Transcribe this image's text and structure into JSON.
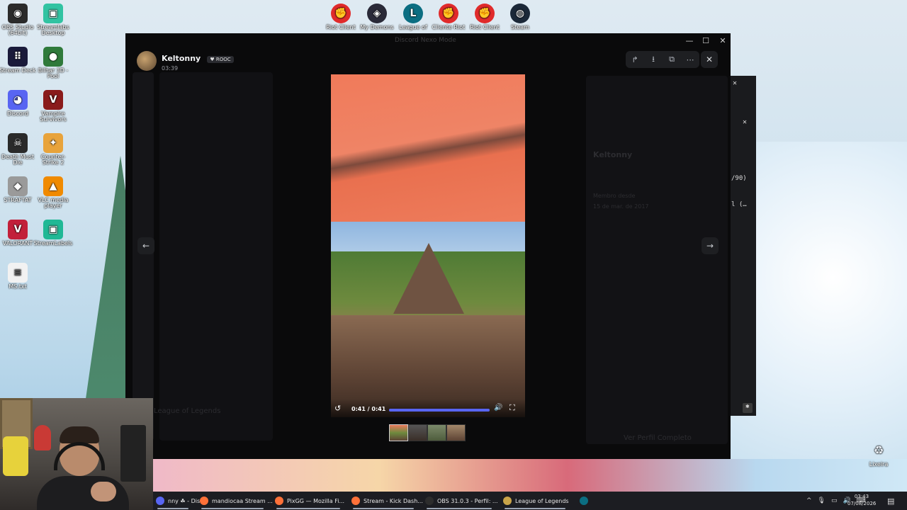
{
  "desktop": {
    "icons_left": [
      {
        "label": "OBS Studio (64bit)",
        "icon": "obs-icon",
        "color": "#2b2b2b",
        "glyph": "◉"
      },
      {
        "label": "Streamlabs Desktop",
        "icon": "streamlabs-icon",
        "color": "#31c3a2",
        "glyph": "▣"
      },
      {
        "label": "Stream Deck",
        "icon": "stream-deck-icon",
        "color": "#1a1a3a",
        "glyph": "⠿"
      },
      {
        "label": "Bilhar 3D - Pool",
        "icon": "pool-game-icon",
        "color": "#2f7a3b",
        "glyph": "●"
      },
      {
        "label": "Discord",
        "icon": "discord-icon",
        "color": "#5865f2",
        "glyph": "◕"
      },
      {
        "label": "Vampire Survivors",
        "icon": "vampire-survivors-icon",
        "color": "#8a1b1b",
        "glyph": "V"
      },
      {
        "label": "Death Must Die",
        "icon": "death-must-die-icon",
        "color": "#2a2a2a",
        "glyph": "☠"
      },
      {
        "label": "Counter-Strike 2",
        "icon": "counter-strike-icon",
        "color": "#e8a33b",
        "glyph": "✦"
      },
      {
        "label": "STRAFTAT",
        "icon": "straftat-icon",
        "color": "#9a9a9a",
        "glyph": "◆"
      },
      {
        "label": "VLC media player",
        "icon": "vlc-icon",
        "color": "#f08a00",
        "glyph": "▲"
      },
      {
        "label": "VALORANT",
        "icon": "valorant-icon",
        "color": "#c2203a",
        "glyph": "V"
      },
      {
        "label": "StreamLabels",
        "icon": "streamlabels-icon",
        "color": "#20b895",
        "glyph": "▣"
      },
      {
        "label": "MS.txt",
        "icon": "text-file-icon",
        "color": "#f2f2f2",
        "glyph": "≡"
      }
    ],
    "icons_top": [
      {
        "label": "Riot Client",
        "icon": "riot-client-icon",
        "color": "#e02b2b",
        "glyph": "✊"
      },
      {
        "label": "My Demons",
        "icon": "my-demons-icon",
        "color": "#2a2a38",
        "glyph": "◈"
      },
      {
        "label": "League of",
        "icon": "league-of-legends-icon",
        "color": "#0b6e82",
        "glyph": "L"
      },
      {
        "label": "Cliente Riot",
        "icon": "riot-client-icon",
        "color": "#e02b2b",
        "glyph": "✊"
      },
      {
        "label": "Riot Client",
        "icon": "riot-client-icon",
        "color": "#e02b2b",
        "glyph": "✊"
      },
      {
        "label": "Steam",
        "icon": "steam-icon",
        "color": "#1b2838",
        "glyph": "◍"
      }
    ],
    "recycle_bin": {
      "label": "Lixeira",
      "icon": "recycle-bin-icon"
    }
  },
  "viewer": {
    "window_title": "Discord Nexo Mode",
    "author": {
      "name": "Keltonny",
      "tag": "ROOC",
      "time": "03:39"
    },
    "toolbar": {
      "forward": "↱",
      "download": "⭳",
      "open": "⧉",
      "more": "⋯",
      "close": "✕"
    },
    "nav": {
      "prev": "←",
      "next": "→"
    },
    "video": {
      "time": "0:41 / 0:41",
      "progress": 1.0,
      "replay": "↺",
      "volume": "🔊",
      "fullscreen": "⛶"
    },
    "background_ghost": {
      "profile_name": "Keltonny",
      "member_since_label": "Membro desde",
      "member_since": "15 de mar. de 2017",
      "full_profile": "Ver Perfil Completo",
      "channel": "League of Legends"
    },
    "window_controls": {
      "minimize": "—",
      "maximize": "☐",
      "close": "✕"
    }
  },
  "side_panel": {
    "count": "/90)",
    "ellipsis": "l (…",
    "close": "✕"
  },
  "taskbar": {
    "items": [
      {
        "label": "nny ☘ - Dis...",
        "icon": "discord-icon",
        "color": "#5865f2",
        "active": true
      },
      {
        "label": "mandiocaa Stream ...",
        "icon": "firefox-icon",
        "color": "#ff7139",
        "active": true
      },
      {
        "label": "PixGG — Mozilla Fi...",
        "icon": "firefox-icon",
        "color": "#ff7139",
        "active": true
      },
      {
        "label": "Stream - Kick Dash...",
        "icon": "firefox-icon",
        "color": "#ff7139",
        "active": true
      },
      {
        "label": "OBS 31.0.3 - Perfil: ...",
        "icon": "obs-icon",
        "color": "#2d2d2d",
        "active": true
      },
      {
        "label": "League of Legends",
        "icon": "league-of-legends-icon",
        "color": "#c9a449",
        "active": true
      },
      {
        "label": "",
        "icon": "league-of-legends-icon",
        "color": "#0b6e82",
        "active": false
      }
    ],
    "tray": {
      "chevron": "^",
      "clock_time": "03:43",
      "clock_date": "07/08/2026"
    }
  }
}
